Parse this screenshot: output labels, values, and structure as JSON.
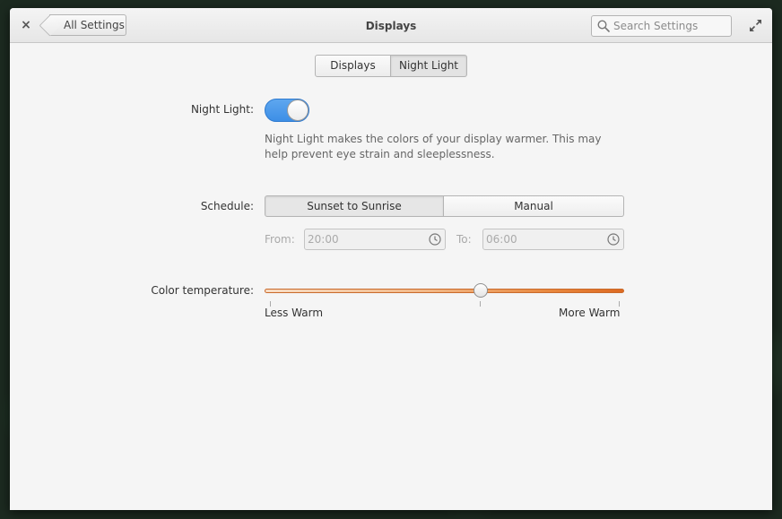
{
  "header": {
    "close_glyph": "×",
    "back_label": "All Settings",
    "title": "Displays",
    "search_placeholder": "Search Settings"
  },
  "tabs": [
    {
      "label": "Displays",
      "selected": false
    },
    {
      "label": "Night Light",
      "selected": true
    }
  ],
  "night_light": {
    "label": "Night Light:",
    "enabled": true,
    "description": "Night Light makes the colors of your display warmer. This may help prevent eye strain and sleeplessness."
  },
  "schedule": {
    "label": "Schedule:",
    "options": [
      "Sunset to Sunrise",
      "Manual"
    ],
    "selected": "Sunset to Sunrise",
    "from_label": "From:",
    "from_value": "20:00",
    "to_label": "To:",
    "to_value": "06:00"
  },
  "color_temperature": {
    "label": "Color temperature:",
    "min_label": "Less Warm",
    "max_label": "More Warm",
    "value_fraction": 0.6
  },
  "colors": {
    "accent": "#3d8fe6",
    "slider_warm": "#dd6a22"
  }
}
